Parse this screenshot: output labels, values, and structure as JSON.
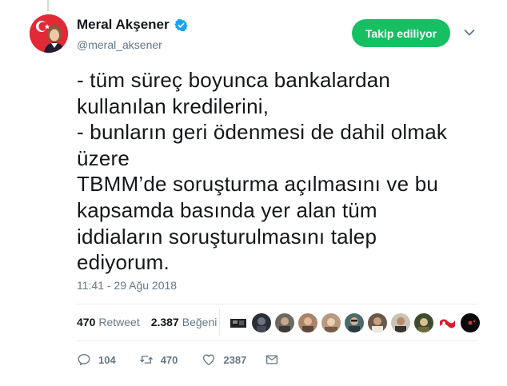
{
  "author": {
    "display_name": "Meral Akşener",
    "handle": "@meral_aksener",
    "verified": true
  },
  "follow_button": {
    "label": "Takip ediliyor",
    "color": "#17bf63"
  },
  "tweet": {
    "lines": [
      "- tüm süreç boyunca bankalardan",
      "kullanılan kredilerini,",
      "- bunların geri ödenmesi de dahil olmak",
      "üzere",
      "TBMM’de soruşturma açılmasını ve bu",
      "kapsamda basında yer alan tüm",
      "iddiaların soruşturulmasını talep",
      "ediyorum."
    ],
    "timestamp": "11:41 - 29 Ağu 2018"
  },
  "stats": {
    "retweet_count": "470",
    "retweet_label": "Retweet",
    "like_count": "2.387",
    "like_label": "Beğeni"
  },
  "actions": {
    "reply_count": "104",
    "retweet_count": "470",
    "like_count": "2387"
  },
  "icons": {
    "reply": "reply-icon",
    "retweet": "retweet-icon",
    "like": "heart-icon",
    "dm": "envelope-icon",
    "verified": "verified-badge-icon",
    "more": "chevron-down-icon"
  }
}
